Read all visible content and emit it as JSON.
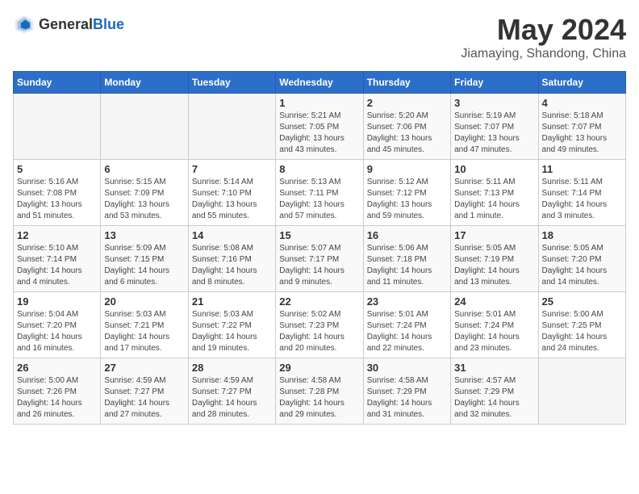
{
  "header": {
    "logo_general": "General",
    "logo_blue": "Blue",
    "title": "May 2024",
    "location": "Jiamaying, Shandong, China"
  },
  "days_of_week": [
    "Sunday",
    "Monday",
    "Tuesday",
    "Wednesday",
    "Thursday",
    "Friday",
    "Saturday"
  ],
  "weeks": [
    [
      {
        "day": "",
        "info": ""
      },
      {
        "day": "",
        "info": ""
      },
      {
        "day": "",
        "info": ""
      },
      {
        "day": "1",
        "info": "Sunrise: 5:21 AM\nSunset: 7:05 PM\nDaylight: 13 hours\nand 43 minutes."
      },
      {
        "day": "2",
        "info": "Sunrise: 5:20 AM\nSunset: 7:06 PM\nDaylight: 13 hours\nand 45 minutes."
      },
      {
        "day": "3",
        "info": "Sunrise: 5:19 AM\nSunset: 7:07 PM\nDaylight: 13 hours\nand 47 minutes."
      },
      {
        "day": "4",
        "info": "Sunrise: 5:18 AM\nSunset: 7:07 PM\nDaylight: 13 hours\nand 49 minutes."
      }
    ],
    [
      {
        "day": "5",
        "info": "Sunrise: 5:16 AM\nSunset: 7:08 PM\nDaylight: 13 hours\nand 51 minutes."
      },
      {
        "day": "6",
        "info": "Sunrise: 5:15 AM\nSunset: 7:09 PM\nDaylight: 13 hours\nand 53 minutes."
      },
      {
        "day": "7",
        "info": "Sunrise: 5:14 AM\nSunset: 7:10 PM\nDaylight: 13 hours\nand 55 minutes."
      },
      {
        "day": "8",
        "info": "Sunrise: 5:13 AM\nSunset: 7:11 PM\nDaylight: 13 hours\nand 57 minutes."
      },
      {
        "day": "9",
        "info": "Sunrise: 5:12 AM\nSunset: 7:12 PM\nDaylight: 13 hours\nand 59 minutes."
      },
      {
        "day": "10",
        "info": "Sunrise: 5:11 AM\nSunset: 7:13 PM\nDaylight: 14 hours\nand 1 minute."
      },
      {
        "day": "11",
        "info": "Sunrise: 5:11 AM\nSunset: 7:14 PM\nDaylight: 14 hours\nand 3 minutes."
      }
    ],
    [
      {
        "day": "12",
        "info": "Sunrise: 5:10 AM\nSunset: 7:14 PM\nDaylight: 14 hours\nand 4 minutes."
      },
      {
        "day": "13",
        "info": "Sunrise: 5:09 AM\nSunset: 7:15 PM\nDaylight: 14 hours\nand 6 minutes."
      },
      {
        "day": "14",
        "info": "Sunrise: 5:08 AM\nSunset: 7:16 PM\nDaylight: 14 hours\nand 8 minutes."
      },
      {
        "day": "15",
        "info": "Sunrise: 5:07 AM\nSunset: 7:17 PM\nDaylight: 14 hours\nand 9 minutes."
      },
      {
        "day": "16",
        "info": "Sunrise: 5:06 AM\nSunset: 7:18 PM\nDaylight: 14 hours\nand 11 minutes."
      },
      {
        "day": "17",
        "info": "Sunrise: 5:05 AM\nSunset: 7:19 PM\nDaylight: 14 hours\nand 13 minutes."
      },
      {
        "day": "18",
        "info": "Sunrise: 5:05 AM\nSunset: 7:20 PM\nDaylight: 14 hours\nand 14 minutes."
      }
    ],
    [
      {
        "day": "19",
        "info": "Sunrise: 5:04 AM\nSunset: 7:20 PM\nDaylight: 14 hours\nand 16 minutes."
      },
      {
        "day": "20",
        "info": "Sunrise: 5:03 AM\nSunset: 7:21 PM\nDaylight: 14 hours\nand 17 minutes."
      },
      {
        "day": "21",
        "info": "Sunrise: 5:03 AM\nSunset: 7:22 PM\nDaylight: 14 hours\nand 19 minutes."
      },
      {
        "day": "22",
        "info": "Sunrise: 5:02 AM\nSunset: 7:23 PM\nDaylight: 14 hours\nand 20 minutes."
      },
      {
        "day": "23",
        "info": "Sunrise: 5:01 AM\nSunset: 7:24 PM\nDaylight: 14 hours\nand 22 minutes."
      },
      {
        "day": "24",
        "info": "Sunrise: 5:01 AM\nSunset: 7:24 PM\nDaylight: 14 hours\nand 23 minutes."
      },
      {
        "day": "25",
        "info": "Sunrise: 5:00 AM\nSunset: 7:25 PM\nDaylight: 14 hours\nand 24 minutes."
      }
    ],
    [
      {
        "day": "26",
        "info": "Sunrise: 5:00 AM\nSunset: 7:26 PM\nDaylight: 14 hours\nand 26 minutes."
      },
      {
        "day": "27",
        "info": "Sunrise: 4:59 AM\nSunset: 7:27 PM\nDaylight: 14 hours\nand 27 minutes."
      },
      {
        "day": "28",
        "info": "Sunrise: 4:59 AM\nSunset: 7:27 PM\nDaylight: 14 hours\nand 28 minutes."
      },
      {
        "day": "29",
        "info": "Sunrise: 4:58 AM\nSunset: 7:28 PM\nDaylight: 14 hours\nand 29 minutes."
      },
      {
        "day": "30",
        "info": "Sunrise: 4:58 AM\nSunset: 7:29 PM\nDaylight: 14 hours\nand 31 minutes."
      },
      {
        "day": "31",
        "info": "Sunrise: 4:57 AM\nSunset: 7:29 PM\nDaylight: 14 hours\nand 32 minutes."
      },
      {
        "day": "",
        "info": ""
      }
    ]
  ]
}
